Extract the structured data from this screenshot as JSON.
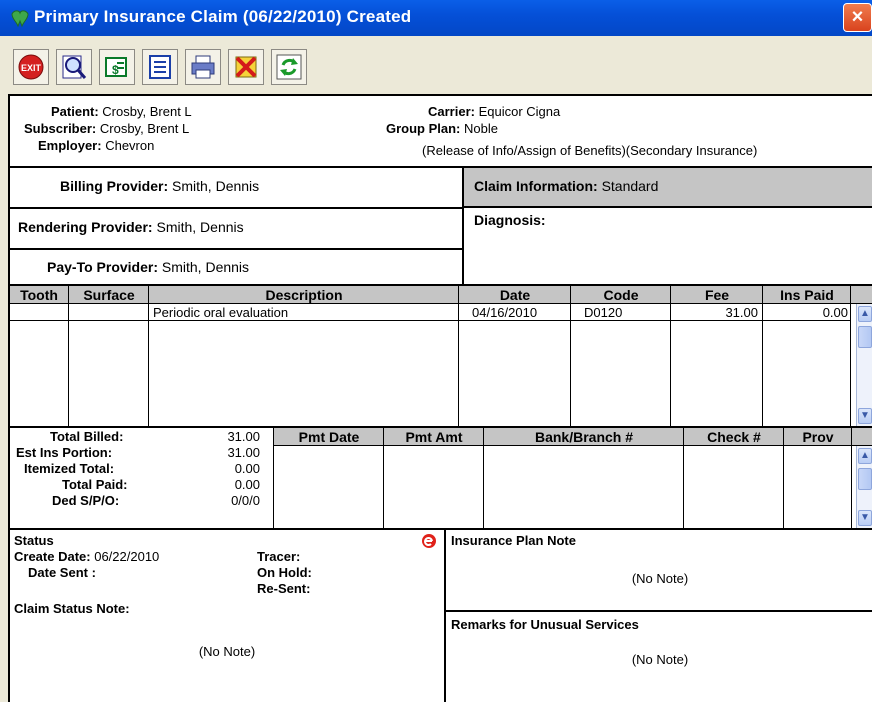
{
  "window": {
    "title": "Primary Insurance Claim (06/22/2010) Created",
    "close_glyph": "×"
  },
  "toolbar": {
    "buttons": [
      {
        "name": "exit",
        "label": "EXIT"
      },
      {
        "name": "preview",
        "label": ""
      },
      {
        "name": "payment",
        "label": ""
      },
      {
        "name": "list",
        "label": ""
      },
      {
        "name": "print",
        "label": ""
      },
      {
        "name": "delete",
        "label": ""
      },
      {
        "name": "refresh",
        "label": ""
      }
    ]
  },
  "header": {
    "patient_label": "Patient:",
    "patient": "Crosby, Brent L",
    "subscriber_label": "Subscriber:",
    "subscriber": "Crosby, Brent L",
    "employer_label": "Employer:",
    "employer": "Chevron",
    "carrier_label": "Carrier:",
    "carrier": "Equicor Cigna",
    "group_plan_label": "Group Plan:",
    "group_plan": "Noble",
    "flags": "(Release of Info/Assign of Benefits)(Secondary Insurance)"
  },
  "providers": {
    "billing_label": "Billing Provider:",
    "billing": "Smith, Dennis",
    "rendering_label": "Rendering Provider:",
    "rendering": "Smith, Dennis",
    "payto_label": "Pay-To Provider:",
    "payto": "Smith, Dennis",
    "claim_info_label": "Claim Information:",
    "claim_info": "Standard",
    "diagnosis_label": "Diagnosis:"
  },
  "procedures": {
    "columns": [
      "Tooth",
      "Surface",
      "Description",
      "Date",
      "Code",
      "Fee",
      "Ins Paid"
    ],
    "rows": [
      {
        "tooth": "",
        "surface": "",
        "description": "Periodic oral evaluation",
        "date": "04/16/2010",
        "code": "D0120",
        "fee": "31.00",
        "ins_paid": "0.00"
      }
    ]
  },
  "totals": {
    "total_billed_label": "Total Billed:",
    "total_billed": "31.00",
    "est_ins_label": "Est Ins Portion:",
    "est_ins": "31.00",
    "itemized_label": "Itemized Total:",
    "itemized": "0.00",
    "total_paid_label": "Total Paid:",
    "total_paid": "0.00",
    "ded_label": "Ded S/P/O:",
    "ded": "0/0/0"
  },
  "payments": {
    "columns": [
      "Pmt Date",
      "Pmt Amt",
      "Bank/Branch #",
      "Check #",
      "Prov"
    ]
  },
  "status": {
    "title": "Status",
    "create_date_label": "Create Date:",
    "create_date": "06/22/2010",
    "tracer_label": "Tracer:",
    "date_sent_label": "Date Sent :",
    "on_hold_label": "On Hold:",
    "re_sent_label": "Re-Sent:",
    "claim_note_label": "Claim Status Note:",
    "claim_note": "(No Note)"
  },
  "notes": {
    "plan_note_label": "Insurance Plan Note",
    "plan_note": "(No Note)",
    "remarks_label": "Remarks for Unusual Services",
    "remarks": "(No Note)"
  },
  "colors": {
    "titlebar": "#0550d8",
    "header_grey": "#c5c5c5",
    "chrome": "#ece9d8"
  }
}
